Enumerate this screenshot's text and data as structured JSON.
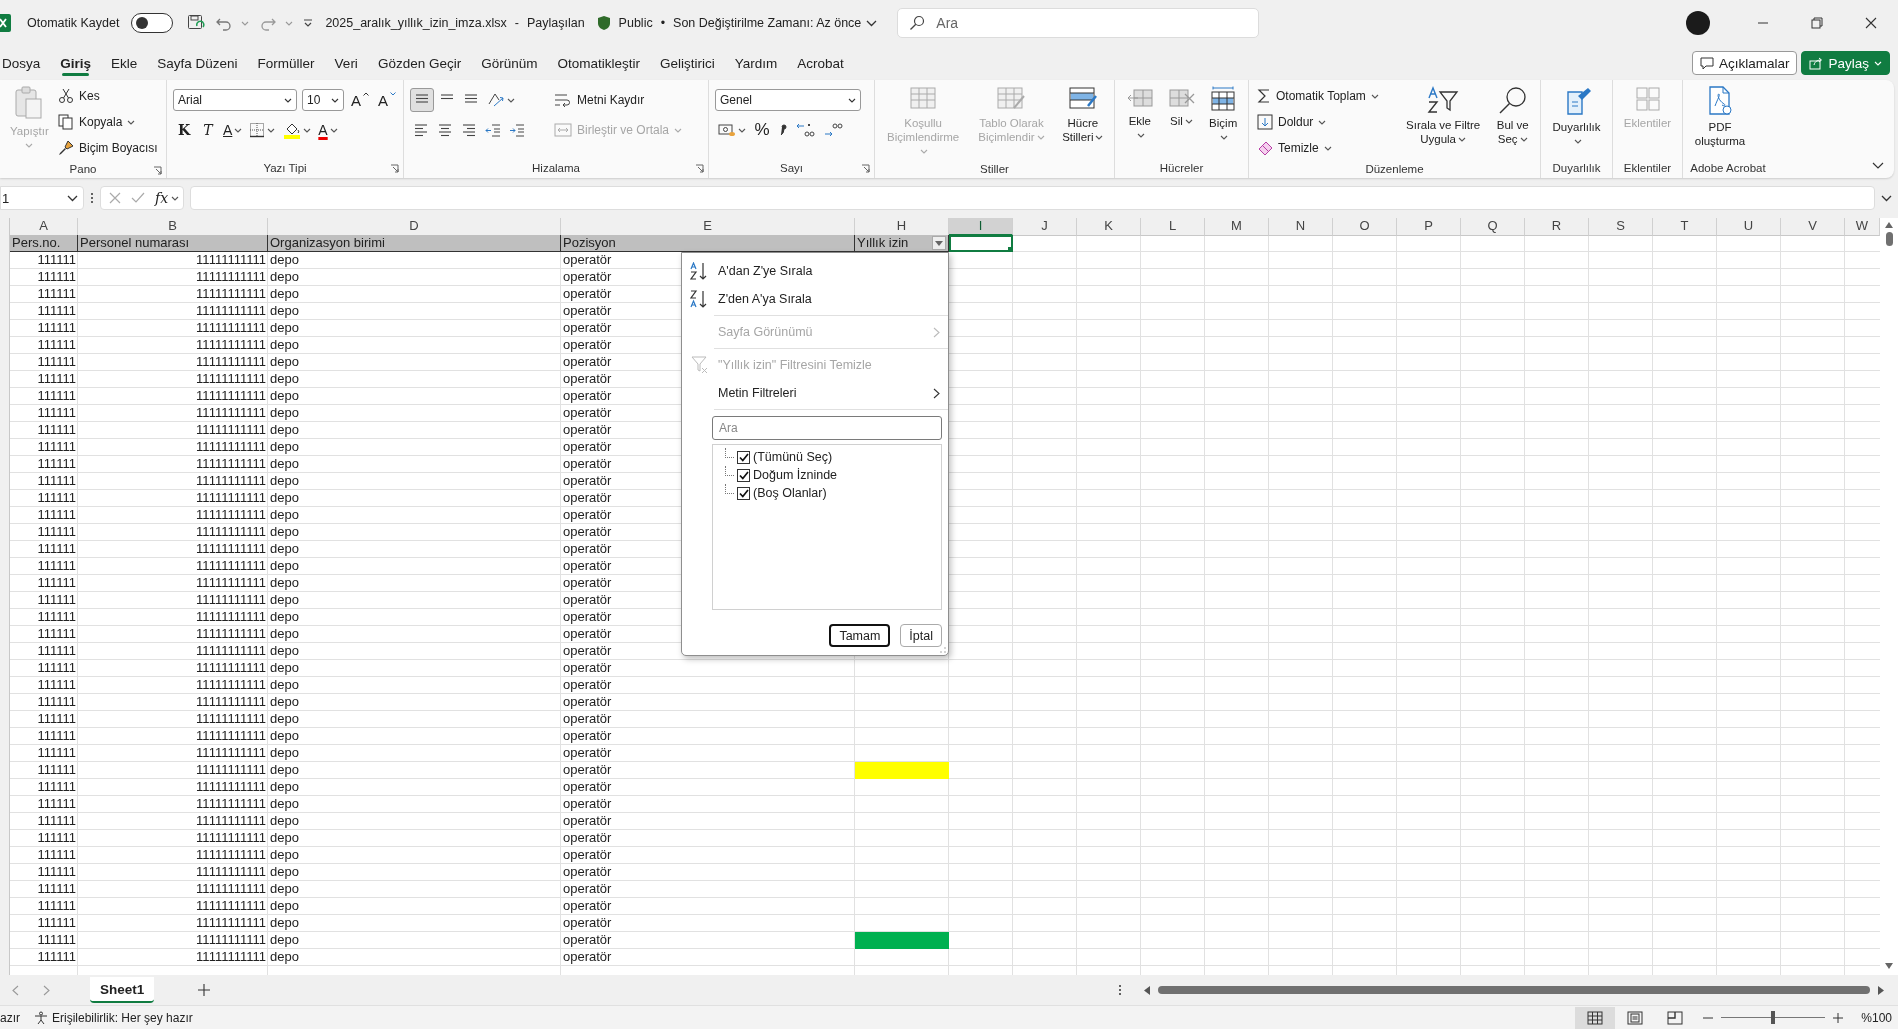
{
  "title_bar": {
    "autosave_label": "Otomatik Kaydet",
    "autosave_on": false,
    "filename": "2025_aralık_yıllık_izin_imza.xlsx",
    "separator": "-",
    "share_state": "Paylaşılan",
    "sensitivity": "Public",
    "dot": "•",
    "modified": "Son Değiştirilme Zamanı: Az önce",
    "search_placeholder": "Ara"
  },
  "menu_tabs": [
    {
      "label": "Dosya",
      "selected": false
    },
    {
      "label": "Giriş",
      "selected": true
    },
    {
      "label": "Ekle",
      "selected": false
    },
    {
      "label": "Sayfa Düzeni",
      "selected": false
    },
    {
      "label": "Formüller",
      "selected": false
    },
    {
      "label": "Veri",
      "selected": false
    },
    {
      "label": "Gözden Geçir",
      "selected": false
    },
    {
      "label": "Görünüm",
      "selected": false
    },
    {
      "label": "Otomatikleştir",
      "selected": false
    },
    {
      "label": "Geliştirici",
      "selected": false
    },
    {
      "label": "Yardım",
      "selected": false
    },
    {
      "label": "Acrobat",
      "selected": false
    }
  ],
  "header_buttons": [
    {
      "label": "Açıklamalar",
      "kind": "outline"
    },
    {
      "label": "Paylaş",
      "kind": "primary"
    }
  ],
  "ribbon": [
    {
      "name": "Pano",
      "items": [
        {
          "label": "Yapıştır",
          "disabled": true
        },
        {
          "label": "Kes",
          "disabled": false
        },
        {
          "label": "Kopyala",
          "disabled": false
        },
        {
          "label": "Biçim Boyacısı",
          "disabled": false
        }
      ]
    },
    {
      "name": "Yazı Tipi",
      "font": "Arial",
      "size": "10",
      "items": [
        {
          "label": "A"
        },
        {
          "label": "A"
        },
        {
          "label": "K"
        },
        {
          "label": "T"
        },
        {
          "label": "A"
        },
        {
          "label": "A"
        }
      ]
    },
    {
      "name": "Hizalama",
      "items": [
        {
          "label": "Metni Kaydır",
          "disabled": false
        },
        {
          "label": "Birleştir ve Ortala",
          "disabled": true
        }
      ]
    },
    {
      "name": "Sayı",
      "format": "Genel",
      "items": [
        {
          "label": "%"
        }
      ]
    },
    {
      "name": "Stiller",
      "items": [
        {
          "label": "Koşullu Biçimlendirme",
          "disabled": true
        },
        {
          "label": "Tablo Olarak Biçimlendir",
          "disabled": true
        },
        {
          "label": "Hücre Stilleri",
          "disabled": false
        }
      ]
    },
    {
      "name": "Hücreler",
      "items": [
        {
          "label": "Ekle",
          "disabled": false
        },
        {
          "label": "Sil",
          "disabled": false
        },
        {
          "label": "Biçim",
          "disabled": false
        }
      ]
    },
    {
      "name": "Düzenleme",
      "items": [
        {
          "label": "Otomatik Toplam",
          "disabled": false
        },
        {
          "label": "Doldur",
          "disabled": false
        },
        {
          "label": "Temizle",
          "disabled": false
        },
        {
          "label": "Sırala ve Filtre Uygula",
          "disabled": false
        },
        {
          "label": "Bul ve Seç",
          "disabled": false
        }
      ]
    },
    {
      "name": "Duyarlılık",
      "items": [
        {
          "label": "Duyarlılık",
          "disabled": false
        }
      ]
    },
    {
      "name": "Eklentiler",
      "items": [
        {
          "label": "Eklentiler",
          "disabled": true
        }
      ]
    },
    {
      "name": "Adobe Acrobat",
      "items": [
        {
          "label": "PDF oluşturma",
          "disabled": false
        }
      ]
    }
  ],
  "formula_bar": {
    "name_box": "1",
    "function_label": "fx"
  },
  "sheet": {
    "columns": [
      {
        "label": "A",
        "selected": false
      },
      {
        "label": "B",
        "selected": false
      },
      {
        "label": "D",
        "selected": false
      },
      {
        "label": "E",
        "selected": false
      },
      {
        "label": "H",
        "selected": false
      },
      {
        "label": "I",
        "selected": true
      },
      {
        "label": "J",
        "selected": false
      },
      {
        "label": "K",
        "selected": false
      },
      {
        "label": "L",
        "selected": false
      },
      {
        "label": "M",
        "selected": false
      },
      {
        "label": "N",
        "selected": false
      },
      {
        "label": "O",
        "selected": false
      },
      {
        "label": "P",
        "selected": false
      },
      {
        "label": "Q",
        "selected": false
      },
      {
        "label": "R",
        "selected": false
      },
      {
        "label": "S",
        "selected": false
      },
      {
        "label": "T",
        "selected": false
      },
      {
        "label": "U",
        "selected": false
      },
      {
        "label": "V",
        "selected": false
      },
      {
        "label": "W",
        "selected": false
      }
    ],
    "headers": [
      "Pers.no.",
      "Personel numarası",
      "Organizasyon birimi",
      "Pozisyon",
      "Yıllık izin"
    ],
    "rows": [
      {
        "pers_no": "111111",
        "personel_no": "11111111111",
        "birim": "depo",
        "pozisyon": "operatör"
      },
      {
        "pers_no": "111111",
        "personel_no": "11111111111",
        "birim": "depo",
        "pozisyon": "operatör"
      },
      {
        "pers_no": "111111",
        "personel_no": "11111111111",
        "birim": "depo",
        "pozisyon": "operatör"
      },
      {
        "pers_no": "111111",
        "personel_no": "11111111111",
        "birim": "depo",
        "pozisyon": "operatör"
      },
      {
        "pers_no": "111111",
        "personel_no": "11111111111",
        "birim": "depo",
        "pozisyon": "operatör"
      },
      {
        "pers_no": "111111",
        "personel_no": "11111111111",
        "birim": "depo",
        "pozisyon": "operatör"
      },
      {
        "pers_no": "111111",
        "personel_no": "11111111111",
        "birim": "depo",
        "pozisyon": "operatör"
      },
      {
        "pers_no": "111111",
        "personel_no": "11111111111",
        "birim": "depo",
        "pozisyon": "operatör"
      },
      {
        "pers_no": "111111",
        "personel_no": "11111111111",
        "birim": "depo",
        "pozisyon": "operatör"
      },
      {
        "pers_no": "111111",
        "personel_no": "11111111111",
        "birim": "depo",
        "pozisyon": "operatör"
      },
      {
        "pers_no": "111111",
        "personel_no": "11111111111",
        "birim": "depo",
        "pozisyon": "operatör"
      },
      {
        "pers_no": "111111",
        "personel_no": "11111111111",
        "birim": "depo",
        "pozisyon": "operatör"
      },
      {
        "pers_no": "111111",
        "personel_no": "11111111111",
        "birim": "depo",
        "pozisyon": "operatör"
      },
      {
        "pers_no": "111111",
        "personel_no": "11111111111",
        "birim": "depo",
        "pozisyon": "operatör"
      },
      {
        "pers_no": "111111",
        "personel_no": "11111111111",
        "birim": "depo",
        "pozisyon": "operatör"
      },
      {
        "pers_no": "111111",
        "personel_no": "11111111111",
        "birim": "depo",
        "pozisyon": "operatör"
      },
      {
        "pers_no": "111111",
        "personel_no": "11111111111",
        "birim": "depo",
        "pozisyon": "operatör"
      },
      {
        "pers_no": "111111",
        "personel_no": "11111111111",
        "birim": "depo",
        "pozisyon": "operatör"
      },
      {
        "pers_no": "111111",
        "personel_no": "11111111111",
        "birim": "depo",
        "pozisyon": "operatör"
      },
      {
        "pers_no": "111111",
        "personel_no": "11111111111",
        "birim": "depo",
        "pozisyon": "operatör"
      },
      {
        "pers_no": "111111",
        "personel_no": "11111111111",
        "birim": "depo",
        "pozisyon": "operatör"
      },
      {
        "pers_no": "111111",
        "personel_no": "11111111111",
        "birim": "depo",
        "pozisyon": "operatör"
      },
      {
        "pers_no": "111111",
        "personel_no": "11111111111",
        "birim": "depo",
        "pozisyon": "operatör"
      },
      {
        "pers_no": "111111",
        "personel_no": "11111111111",
        "birim": "depo",
        "pozisyon": "operatör"
      },
      {
        "pers_no": "111111",
        "personel_no": "11111111111",
        "birim": "depo",
        "pozisyon": "operatör"
      },
      {
        "pers_no": "111111",
        "personel_no": "11111111111",
        "birim": "depo",
        "pozisyon": "operatör"
      },
      {
        "pers_no": "111111",
        "personel_no": "11111111111",
        "birim": "depo",
        "pozisyon": "operatör"
      },
      {
        "pers_no": "111111",
        "personel_no": "11111111111",
        "birim": "depo",
        "pozisyon": "operatör"
      },
      {
        "pers_no": "111111",
        "personel_no": "11111111111",
        "birim": "depo",
        "pozisyon": "operatör"
      },
      {
        "pers_no": "111111",
        "personel_no": "11111111111",
        "birim": "depo",
        "pozisyon": "operatör"
      },
      {
        "pers_no": "111111",
        "personel_no": "11111111111",
        "birim": "depo",
        "pozisyon": "operatör",
        "color": "#ffff00"
      },
      {
        "pers_no": "111111",
        "personel_no": "11111111111",
        "birim": "depo",
        "pozisyon": "operatör"
      },
      {
        "pers_no": "111111",
        "personel_no": "11111111111",
        "birim": "depo",
        "pozisyon": "operatör"
      },
      {
        "pers_no": "111111",
        "personel_no": "11111111111",
        "birim": "depo",
        "pozisyon": "operatör"
      },
      {
        "pers_no": "111111",
        "personel_no": "11111111111",
        "birim": "depo",
        "pozisyon": "operatör"
      },
      {
        "pers_no": "111111",
        "personel_no": "11111111111",
        "birim": "depo",
        "pozisyon": "operatör"
      },
      {
        "pers_no": "111111",
        "personel_no": "11111111111",
        "birim": "depo",
        "pozisyon": "operatör"
      },
      {
        "pers_no": "111111",
        "personel_no": "11111111111",
        "birim": "depo",
        "pozisyon": "operatör"
      },
      {
        "pers_no": "111111",
        "personel_no": "11111111111",
        "birim": "depo",
        "pozisyon": "operatör"
      },
      {
        "pers_no": "111111",
        "personel_no": "11111111111",
        "birim": "depo",
        "pozisyon": "operatör"
      },
      {
        "pers_no": "111111",
        "personel_no": "11111111111",
        "birim": "depo",
        "pozisyon": "operatör",
        "color": "#00b050"
      },
      {
        "pers_no": "111111",
        "personel_no": "11111111111",
        "birim": "depo",
        "pozisyon": "operatör"
      }
    ]
  },
  "filter_menu": {
    "items": [
      {
        "label": "A'dan Z'ye Sırala",
        "kind": "sort_asc",
        "disabled": false,
        "separator_after": false
      },
      {
        "label": "Z'den A'ya Sırala",
        "kind": "sort_desc",
        "disabled": false,
        "separator_after": true
      },
      {
        "label": "Sayfa Görünümü",
        "kind": "submenu",
        "disabled": true,
        "separator_after": true
      },
      {
        "label": "\"Yıllık izin\" Filtresini Temizle",
        "kind": "clear",
        "disabled": true,
        "separator_after": false
      },
      {
        "label": "Metin Filtreleri",
        "kind": "submenu",
        "disabled": false,
        "separator_after": true
      }
    ],
    "search_placeholder": "Ara",
    "values": [
      {
        "label": "(Tümünü Seç)",
        "checked": true
      },
      {
        "label": "Doğum İzninde",
        "checked": true
      },
      {
        "label": "(Boş Olanlar)",
        "checked": true
      }
    ],
    "buttons": [
      {
        "label": "Tamam",
        "kind": "default"
      },
      {
        "label": "İptal",
        "kind": "normal"
      }
    ]
  },
  "sheet_tabs": [
    {
      "label": "Sheet1",
      "selected": true
    }
  ],
  "status_bar": {
    "ready": "azır",
    "accessibility": "Erişilebilirlik: Her şey hazır",
    "views": [
      {
        "selected": true
      },
      {
        "selected": false
      },
      {
        "selected": false
      }
    ],
    "zoom": {
      "level": 0.5,
      "label": "%100"
    }
  }
}
